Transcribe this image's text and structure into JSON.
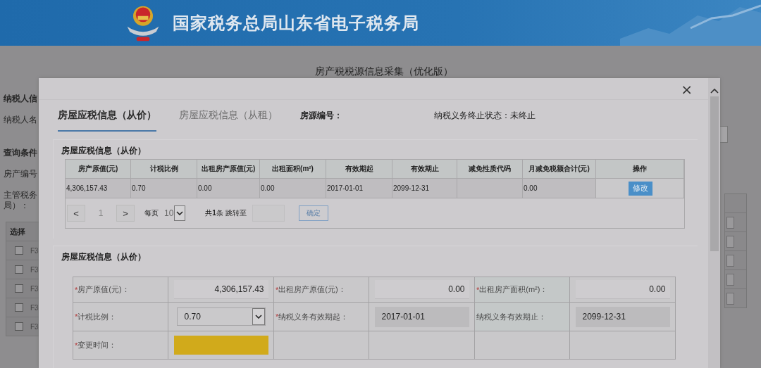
{
  "header": {
    "title": "国家税务总局山东省电子税务局"
  },
  "page": {
    "title": "房产税税源信息采集（优化版）",
    "left_labels": [
      {
        "kind": "heading",
        "lines": [
          "纳税人信"
        ]
      },
      {
        "kind": "label",
        "lines": [
          "纳税人名"
        ]
      },
      {
        "kind": "heading",
        "lines": [
          "查询条件"
        ]
      },
      {
        "kind": "label",
        "lines": [
          "房产编号"
        ]
      },
      {
        "kind": "label",
        "lines": [
          "主管税务",
          "局）："
        ]
      }
    ],
    "table": {
      "columns": [
        "选择"
      ],
      "rows": [
        {
          "checked": false,
          "code": "F3"
        },
        {
          "checked": false,
          "code": "F3"
        },
        {
          "checked": false,
          "code": "F3"
        },
        {
          "checked": false,
          "code": "F3"
        },
        {
          "checked": false,
          "code": "F3"
        }
      ]
    }
  },
  "dialog": {
    "close": "×",
    "tabs": [
      {
        "label": "房屋应税信息（从价）",
        "selected": true
      },
      {
        "label": "房屋应税信息（从租）",
        "selected": false
      }
    ],
    "info": [
      {
        "text": "房源编号："
      },
      {
        "text": "纳税义务终止状态：未终止"
      }
    ],
    "list_panel": {
      "title": "房屋应税信息（从价）",
      "columns": [
        "房产原值(元)",
        "计税比例",
        "出租房产原值(元)",
        "出租面积(m²)",
        "有效期起",
        "有效期止",
        "减免性质代码",
        "月减免税额合计(元)",
        "操作"
      ],
      "rows": [
        {
          "cells": [
            "4,306,157.43",
            "0.70",
            "0.00",
            "0.00",
            "2017-01-01",
            "2099-12-31",
            "",
            "0.00"
          ],
          "action": "修改"
        }
      ],
      "pager": {
        "prev": "<",
        "page": "1",
        "next": ">",
        "per_page_label": "每页",
        "per_page": "10",
        "total": "共**1**条 跳转至",
        "confirm": "确定"
      }
    },
    "form_panel": {
      "title": "房屋应税信息（从价）",
      "rows": [
        [
          {
            "mark": "*",
            "label": "房产原值(元)：",
            "kind": "input",
            "value": "4,306,157.43"
          },
          {
            "mark": "*",
            "label": "出租房产原值(元)：",
            "kind": "input",
            "value": "0.00"
          },
          {
            "mark": "*",
            "label": "出租房产面积(m²)：",
            "kind": "input",
            "value": "0.00"
          }
        ],
        [
          {
            "mark": "*",
            "label": "计税比例：",
            "kind": "select",
            "value": "0.70"
          },
          {
            "mark": "*",
            "label": "纳税义务有效期起：",
            "kind": "readonly",
            "value": "2017-01-01"
          },
          {
            "label": "纳税义务有效期止：",
            "kind": "readonly",
            "value": "2099-12-31"
          }
        ],
        [
          {
            "mark": "*",
            "label": "变更时间：",
            "kind": "highlight"
          },
          {
            "kind": "empty"
          },
          {
            "kind": "empty"
          }
        ]
      ]
    }
  }
}
